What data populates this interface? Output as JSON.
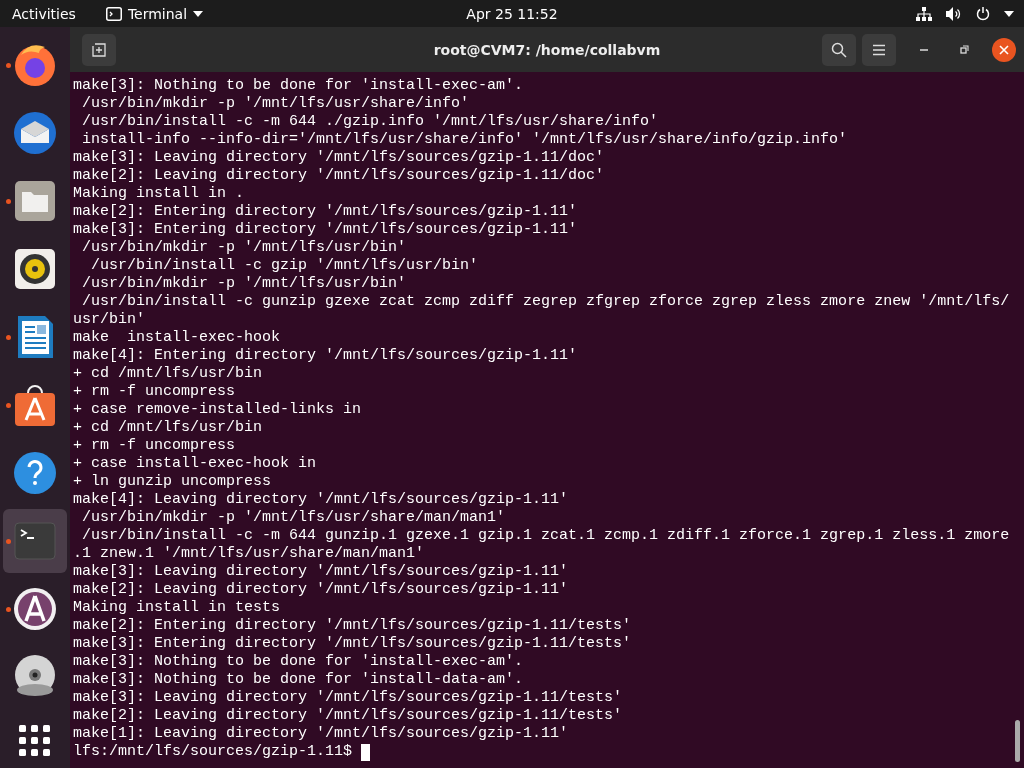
{
  "top_bar": {
    "activities": "Activities",
    "app_menu": "Terminal",
    "clock": "Apr 25  11:52"
  },
  "dock": {
    "items": [
      {
        "kind": "browser",
        "running": true,
        "selected": false
      },
      {
        "kind": "mail",
        "running": false,
        "selected": false
      },
      {
        "kind": "files",
        "running": true,
        "selected": false
      },
      {
        "kind": "music",
        "running": false,
        "selected": false
      },
      {
        "kind": "writer",
        "running": true,
        "selected": false
      },
      {
        "kind": "store",
        "running": true,
        "selected": false
      },
      {
        "kind": "help",
        "running": false,
        "selected": false
      },
      {
        "kind": "terminal",
        "running": true,
        "selected": true
      },
      {
        "kind": "updater",
        "running": true,
        "selected": false
      },
      {
        "kind": "disc",
        "running": false,
        "selected": false
      }
    ]
  },
  "window": {
    "title": "root@CVM7: /home/collabvm"
  },
  "terminal": {
    "lines": [
      "make[3]: Nothing to be done for 'install-exec-am'.",
      " /usr/bin/mkdir -p '/mnt/lfs/usr/share/info'",
      " /usr/bin/install -c -m 644 ./gzip.info '/mnt/lfs/usr/share/info'",
      " install-info --info-dir='/mnt/lfs/usr/share/info' '/mnt/lfs/usr/share/info/gzip.info'",
      "make[3]: Leaving directory '/mnt/lfs/sources/gzip-1.11/doc'",
      "make[2]: Leaving directory '/mnt/lfs/sources/gzip-1.11/doc'",
      "Making install in .",
      "make[2]: Entering directory '/mnt/lfs/sources/gzip-1.11'",
      "make[3]: Entering directory '/mnt/lfs/sources/gzip-1.11'",
      " /usr/bin/mkdir -p '/mnt/lfs/usr/bin'",
      "  /usr/bin/install -c gzip '/mnt/lfs/usr/bin'",
      " /usr/bin/mkdir -p '/mnt/lfs/usr/bin'",
      " /usr/bin/install -c gunzip gzexe zcat zcmp zdiff zegrep zfgrep zforce zgrep zless zmore znew '/mnt/lfs/",
      "usr/bin'",
      "make  install-exec-hook",
      "make[4]: Entering directory '/mnt/lfs/sources/gzip-1.11'",
      "+ cd /mnt/lfs/usr/bin",
      "+ rm -f uncompress",
      "+ case remove-installed-links in",
      "+ cd /mnt/lfs/usr/bin",
      "+ rm -f uncompress",
      "+ case install-exec-hook in",
      "+ ln gunzip uncompress",
      "make[4]: Leaving directory '/mnt/lfs/sources/gzip-1.11'",
      " /usr/bin/mkdir -p '/mnt/lfs/usr/share/man/man1'",
      " /usr/bin/install -c -m 644 gunzip.1 gzexe.1 gzip.1 zcat.1 zcmp.1 zdiff.1 zforce.1 zgrep.1 zless.1 zmore",
      ".1 znew.1 '/mnt/lfs/usr/share/man/man1'",
      "make[3]: Leaving directory '/mnt/lfs/sources/gzip-1.11'",
      "make[2]: Leaving directory '/mnt/lfs/sources/gzip-1.11'",
      "Making install in tests",
      "make[2]: Entering directory '/mnt/lfs/sources/gzip-1.11/tests'",
      "make[3]: Entering directory '/mnt/lfs/sources/gzip-1.11/tests'",
      "make[3]: Nothing to be done for 'install-exec-am'.",
      "make[3]: Nothing to be done for 'install-data-am'.",
      "make[3]: Leaving directory '/mnt/lfs/sources/gzip-1.11/tests'",
      "make[2]: Leaving directory '/mnt/lfs/sources/gzip-1.11/tests'",
      "make[1]: Leaving directory '/mnt/lfs/sources/gzip-1.11'"
    ],
    "prompt": "lfs:/mnt/lfs/sources/gzip-1.11$ "
  }
}
